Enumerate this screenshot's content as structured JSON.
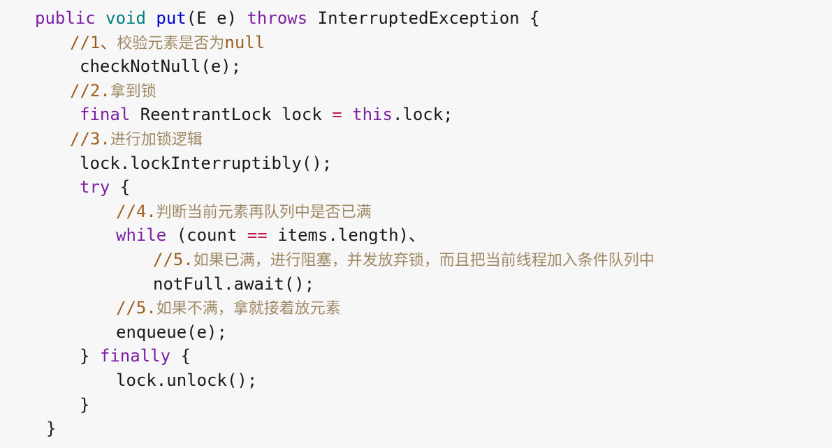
{
  "editor": {
    "background_color": "#f7f7f7",
    "language": "java",
    "font_size_px": 24
  },
  "theme": {
    "keyword_color": "#7b1fa2",
    "type_color": "#008080",
    "method_color": "#0000cc",
    "operator_color": "#c2185b",
    "plain_color": "#1a1a1a",
    "comment_mark_color": "#9c5e1e",
    "comment_text_color": "#a08a66"
  },
  "code": {
    "lines": [
      {
        "id": "line-1-method-signature",
        "indent": "ind-0",
        "tokens": [
          {
            "t": "public",
            "c": "tok-keyword"
          },
          {
            "t": " ",
            "c": "tok-plain"
          },
          {
            "t": "void",
            "c": "tok-type"
          },
          {
            "t": " ",
            "c": "tok-plain"
          },
          {
            "t": "put",
            "c": "tok-method"
          },
          {
            "t": "(E e) ",
            "c": "tok-plain"
          },
          {
            "t": "throws",
            "c": "tok-keyword"
          },
          {
            "t": " InterruptedException {",
            "c": "tok-plain"
          }
        ]
      },
      {
        "id": "line-2-comment-1",
        "indent": "ind-1c",
        "tokens": [
          {
            "t": "//1、",
            "c": "tok-comment-mark"
          },
          {
            "t": "校验元素是否为",
            "c": "tok-comment-text"
          },
          {
            "t": "null",
            "c": "tok-comment-mark"
          }
        ]
      },
      {
        "id": "line-3-checknotnull",
        "indent": "ind-1",
        "tokens": [
          {
            "t": "checkNotNull(e);",
            "c": "tok-plain"
          }
        ]
      },
      {
        "id": "line-4-comment-2",
        "indent": "ind-1c",
        "tokens": [
          {
            "t": "//2.",
            "c": "tok-comment-mark"
          },
          {
            "t": "拿到锁",
            "c": "tok-comment-text"
          }
        ]
      },
      {
        "id": "line-5-final-lock",
        "indent": "ind-1",
        "tokens": [
          {
            "t": "final",
            "c": "tok-keyword"
          },
          {
            "t": " ReentrantLock lock ",
            "c": "tok-plain"
          },
          {
            "t": "=",
            "c": "tok-operator"
          },
          {
            "t": " ",
            "c": "tok-plain"
          },
          {
            "t": "this",
            "c": "tok-keyword"
          },
          {
            "t": ".lock;",
            "c": "tok-plain"
          }
        ]
      },
      {
        "id": "line-6-comment-3",
        "indent": "ind-1c",
        "tokens": [
          {
            "t": "//3.",
            "c": "tok-comment-mark"
          },
          {
            "t": "进行加锁逻辑",
            "c": "tok-comment-text"
          }
        ]
      },
      {
        "id": "line-7-lockinterruptibly",
        "indent": "ind-1",
        "tokens": [
          {
            "t": "lock.lockInterruptibly();",
            "c": "tok-plain"
          }
        ]
      },
      {
        "id": "line-8-try",
        "indent": "ind-1",
        "tokens": [
          {
            "t": "try",
            "c": "tok-keyword"
          },
          {
            "t": " {",
            "c": "tok-plain"
          }
        ]
      },
      {
        "id": "line-9-comment-4",
        "indent": "ind-2c",
        "tokens": [
          {
            "t": "//4.",
            "c": "tok-comment-mark"
          },
          {
            "t": "判断当前元素再队列中是否已满",
            "c": "tok-comment-text"
          }
        ]
      },
      {
        "id": "line-10-while",
        "indent": "ind-2",
        "tokens": [
          {
            "t": "while",
            "c": "tok-keyword"
          },
          {
            "t": " (count ",
            "c": "tok-plain"
          },
          {
            "t": "==",
            "c": "tok-operator"
          },
          {
            "t": " items.length)、",
            "c": "tok-plain"
          }
        ]
      },
      {
        "id": "line-11-comment-5a",
        "indent": "ind-3c",
        "tokens": [
          {
            "t": "//5.",
            "c": "tok-comment-mark"
          },
          {
            "t": "如果已满，进行阻塞，并发放弃锁，而且把当前线程加入条件队列中",
            "c": "tok-comment-text"
          }
        ]
      },
      {
        "id": "line-12-notfull-await",
        "indent": "ind-3",
        "tokens": [
          {
            "t": "notFull.await();",
            "c": "tok-plain"
          }
        ]
      },
      {
        "id": "line-13-comment-5b",
        "indent": "ind-2c",
        "tokens": [
          {
            "t": "//5.",
            "c": "tok-comment-mark"
          },
          {
            "t": "如果不满，拿就接着放元素",
            "c": "tok-comment-text"
          }
        ]
      },
      {
        "id": "line-14-enqueue",
        "indent": "ind-2",
        "tokens": [
          {
            "t": "enqueue(e);",
            "c": "tok-plain"
          }
        ]
      },
      {
        "id": "line-15-finally",
        "indent": "ind-1",
        "tokens": [
          {
            "t": "} ",
            "c": "tok-plain"
          },
          {
            "t": "finally",
            "c": "tok-keyword"
          },
          {
            "t": " {",
            "c": "tok-plain"
          }
        ]
      },
      {
        "id": "line-16-unlock",
        "indent": "ind-2",
        "tokens": [
          {
            "t": "lock.unlock();",
            "c": "tok-plain"
          }
        ]
      },
      {
        "id": "line-17-close-finally",
        "indent": "ind-1",
        "tokens": [
          {
            "t": "}",
            "c": "tok-plain"
          }
        ]
      },
      {
        "id": "line-18-close-method",
        "indent": "ind-cl",
        "tokens": [
          {
            "t": "}",
            "c": "tok-plain"
          }
        ]
      }
    ]
  }
}
